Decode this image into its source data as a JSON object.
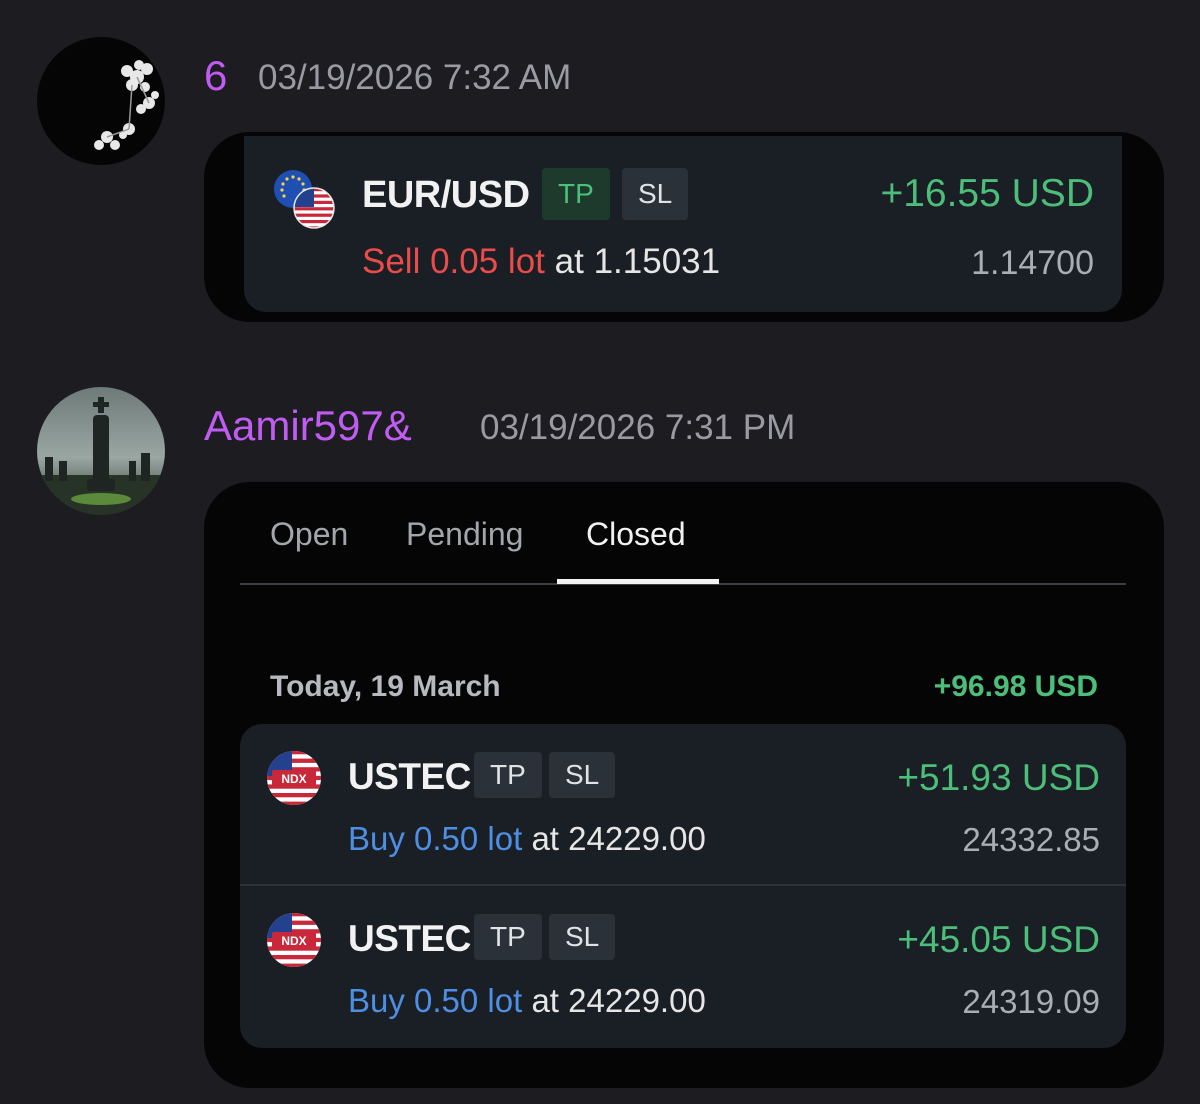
{
  "messages": [
    {
      "username": "6",
      "timestamp": "03/19/2026 7:32 AM",
      "trade": {
        "symbol": "EUR/USD",
        "tp_label": "TP",
        "sl_label": "SL",
        "profit": "+16.55 USD",
        "side": "Sell 0.05 lot",
        "at_label": "at",
        "open_price": "1.15031",
        "close_price": "1.14700"
      }
    },
    {
      "username": "Aamir597&",
      "timestamp": "03/19/2026 7:31 PM",
      "tabs": [
        "Open",
        "Pending",
        "Closed"
      ],
      "active_tab": "Closed",
      "day_group": {
        "label": "Today, 19 March",
        "total": "+96.98 USD"
      },
      "trades": [
        {
          "symbol": "USTEC",
          "badge": "NDX",
          "tp_label": "TP",
          "sl_label": "SL",
          "profit": "+51.93 USD",
          "side": "Buy 0.50 lot",
          "at_label": "at",
          "open_price": "24229.00",
          "close_price": "24332.85"
        },
        {
          "symbol": "USTEC",
          "badge": "NDX",
          "tp_label": "TP",
          "sl_label": "SL",
          "profit": "+45.05 USD",
          "side": "Buy 0.50 lot",
          "at_label": "at",
          "open_price": "24229.00",
          "close_price": "24319.09"
        }
      ]
    }
  ],
  "colors": {
    "background": "#1c1c21",
    "username": "#c05cf2",
    "profit": "#4cbe7a",
    "sell": "#ea4b4b",
    "buy": "#4e8fe4"
  },
  "icons": {
    "avatar_1": "white-flowers-avatar-icon",
    "avatar_2": "chess-king-avatar-icon",
    "eurusd_flag": "eu-us-flag-icon",
    "ustec_flag": "us-ndx-flag-icon"
  }
}
